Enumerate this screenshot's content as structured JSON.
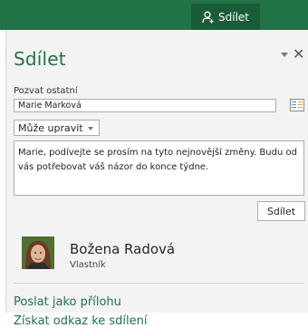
{
  "ribbon": {
    "share_tab_label": "Sdílet",
    "accent": "#217346"
  },
  "pane": {
    "title": "Sdílet",
    "invite_label": "Pozvat ostatní",
    "invite_value": "Marie Marková",
    "permission_selected": "Může upravit",
    "message": "Marie, podívejte se prosím na tyto nejnovější změny. Budu od vás potřebovat váš názor do konce týdne.",
    "share_button_label": "Sdílet"
  },
  "shared_with": [
    {
      "name": "Božena Radová",
      "role": "Vlastník",
      "avatar_icon": "person-photo"
    }
  ],
  "links": {
    "send_attachment": "Poslat jako přílohu",
    "get_link": "Získat odkaz ke sdílení"
  },
  "icons": {
    "share": "person-add-icon",
    "pin": "chevron-down-icon",
    "close": "close-icon",
    "address_book": "address-book-icon"
  }
}
